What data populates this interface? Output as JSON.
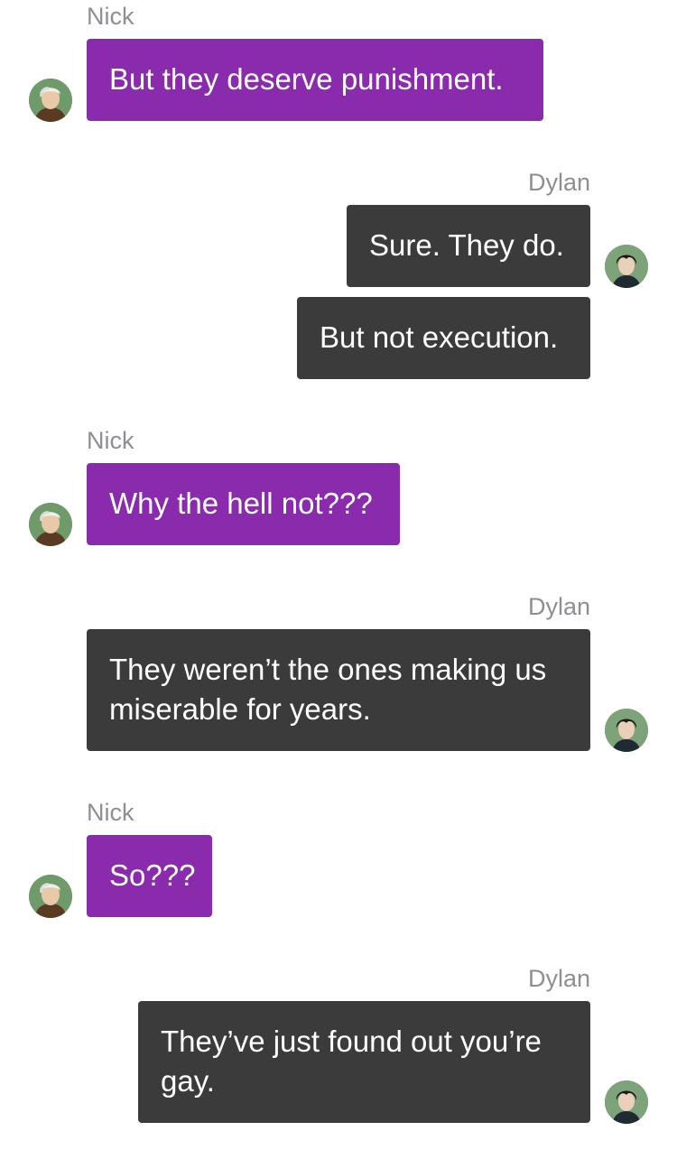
{
  "conversation": {
    "messages": [
      {
        "sender": "Nick",
        "side": "left",
        "text": "But they deserve punishment."
      },
      {
        "sender": "Dylan",
        "side": "right",
        "text": "Sure. They do."
      },
      {
        "sender": "Dylan",
        "side": "right",
        "text": "But not execution."
      },
      {
        "sender": "Nick",
        "side": "left",
        "text": "Why the hell not???"
      },
      {
        "sender": "Dylan",
        "side": "right",
        "text": "They weren’t the ones making us miserable for years."
      },
      {
        "sender": "Nick",
        "side": "left",
        "text": "So???"
      },
      {
        "sender": "Dylan",
        "side": "right",
        "text": "They’ve just found out you’re gay."
      }
    ],
    "colors": {
      "nick_bubble": "#8a2aac",
      "dylan_bubble": "#3b3b3b",
      "sender_label": "#8e8e93",
      "background": "#ffffff"
    }
  }
}
